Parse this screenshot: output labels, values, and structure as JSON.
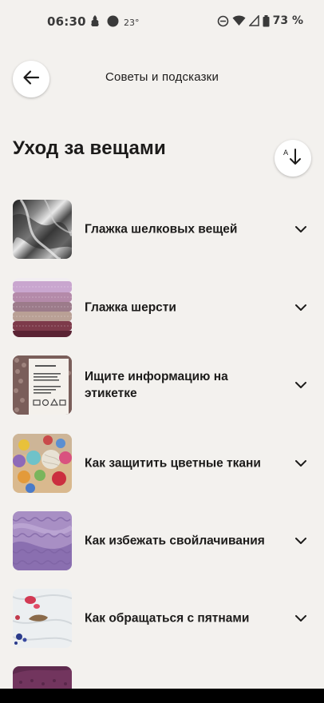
{
  "status_bar": {
    "time": "06:30",
    "temperature": "23°",
    "battery": "73 %"
  },
  "header": {
    "title": "Советы и подсказки"
  },
  "section": {
    "title": "Уход за вещами"
  },
  "tips": [
    {
      "label": "Глажка шелковых вещей",
      "thumb": "silk-fabric"
    },
    {
      "label": "Глажка шерсти",
      "thumb": "stacked-sweaters"
    },
    {
      "label": "Ищите информацию на этикетке",
      "thumb": "care-label"
    },
    {
      "label": "Как защитить цветные ткани",
      "thumb": "yarn-balls"
    },
    {
      "label": "Как избежать свойлачивания",
      "thumb": "purple-knit"
    },
    {
      "label": "Как обращаться с пятнами",
      "thumb": "stained-cloth"
    },
    {
      "label": "",
      "thumb": "purple-fabric"
    }
  ],
  "colors": {
    "background": "#f3f1ee",
    "surface": "#ffffff",
    "text": "#1c1b1a"
  }
}
